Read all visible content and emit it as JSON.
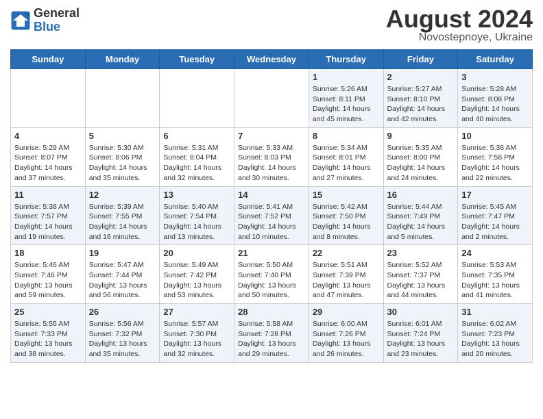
{
  "logo": {
    "general": "General",
    "blue": "Blue"
  },
  "title": "August 2024",
  "location": "Novostepnoye, Ukraine",
  "days_of_week": [
    "Sunday",
    "Monday",
    "Tuesday",
    "Wednesday",
    "Thursday",
    "Friday",
    "Saturday"
  ],
  "weeks": [
    [
      {
        "day": "",
        "info": ""
      },
      {
        "day": "",
        "info": ""
      },
      {
        "day": "",
        "info": ""
      },
      {
        "day": "",
        "info": ""
      },
      {
        "day": "1",
        "info": "Sunrise: 5:26 AM\nSunset: 8:11 PM\nDaylight: 14 hours\nand 45 minutes."
      },
      {
        "day": "2",
        "info": "Sunrise: 5:27 AM\nSunset: 8:10 PM\nDaylight: 14 hours\nand 42 minutes."
      },
      {
        "day": "3",
        "info": "Sunrise: 5:28 AM\nSunset: 8:08 PM\nDaylight: 14 hours\nand 40 minutes."
      }
    ],
    [
      {
        "day": "4",
        "info": "Sunrise: 5:29 AM\nSunset: 8:07 PM\nDaylight: 14 hours\nand 37 minutes."
      },
      {
        "day": "5",
        "info": "Sunrise: 5:30 AM\nSunset: 8:06 PM\nDaylight: 14 hours\nand 35 minutes."
      },
      {
        "day": "6",
        "info": "Sunrise: 5:31 AM\nSunset: 8:04 PM\nDaylight: 14 hours\nand 32 minutes."
      },
      {
        "day": "7",
        "info": "Sunrise: 5:33 AM\nSunset: 8:03 PM\nDaylight: 14 hours\nand 30 minutes."
      },
      {
        "day": "8",
        "info": "Sunrise: 5:34 AM\nSunset: 8:01 PM\nDaylight: 14 hours\nand 27 minutes."
      },
      {
        "day": "9",
        "info": "Sunrise: 5:35 AM\nSunset: 8:00 PM\nDaylight: 14 hours\nand 24 minutes."
      },
      {
        "day": "10",
        "info": "Sunrise: 5:36 AM\nSunset: 7:58 PM\nDaylight: 14 hours\nand 22 minutes."
      }
    ],
    [
      {
        "day": "11",
        "info": "Sunrise: 5:38 AM\nSunset: 7:57 PM\nDaylight: 14 hours\nand 19 minutes."
      },
      {
        "day": "12",
        "info": "Sunrise: 5:39 AM\nSunset: 7:55 PM\nDaylight: 14 hours\nand 16 minutes."
      },
      {
        "day": "13",
        "info": "Sunrise: 5:40 AM\nSunset: 7:54 PM\nDaylight: 14 hours\nand 13 minutes."
      },
      {
        "day": "14",
        "info": "Sunrise: 5:41 AM\nSunset: 7:52 PM\nDaylight: 14 hours\nand 10 minutes."
      },
      {
        "day": "15",
        "info": "Sunrise: 5:42 AM\nSunset: 7:50 PM\nDaylight: 14 hours\nand 8 minutes."
      },
      {
        "day": "16",
        "info": "Sunrise: 5:44 AM\nSunset: 7:49 PM\nDaylight: 14 hours\nand 5 minutes."
      },
      {
        "day": "17",
        "info": "Sunrise: 5:45 AM\nSunset: 7:47 PM\nDaylight: 14 hours\nand 2 minutes."
      }
    ],
    [
      {
        "day": "18",
        "info": "Sunrise: 5:46 AM\nSunset: 7:46 PM\nDaylight: 13 hours\nand 59 minutes."
      },
      {
        "day": "19",
        "info": "Sunrise: 5:47 AM\nSunset: 7:44 PM\nDaylight: 13 hours\nand 56 minutes."
      },
      {
        "day": "20",
        "info": "Sunrise: 5:49 AM\nSunset: 7:42 PM\nDaylight: 13 hours\nand 53 minutes."
      },
      {
        "day": "21",
        "info": "Sunrise: 5:50 AM\nSunset: 7:40 PM\nDaylight: 13 hours\nand 50 minutes."
      },
      {
        "day": "22",
        "info": "Sunrise: 5:51 AM\nSunset: 7:39 PM\nDaylight: 13 hours\nand 47 minutes."
      },
      {
        "day": "23",
        "info": "Sunrise: 5:52 AM\nSunset: 7:37 PM\nDaylight: 13 hours\nand 44 minutes."
      },
      {
        "day": "24",
        "info": "Sunrise: 5:53 AM\nSunset: 7:35 PM\nDaylight: 13 hours\nand 41 minutes."
      }
    ],
    [
      {
        "day": "25",
        "info": "Sunrise: 5:55 AM\nSunset: 7:33 PM\nDaylight: 13 hours\nand 38 minutes."
      },
      {
        "day": "26",
        "info": "Sunrise: 5:56 AM\nSunset: 7:32 PM\nDaylight: 13 hours\nand 35 minutes."
      },
      {
        "day": "27",
        "info": "Sunrise: 5:57 AM\nSunset: 7:30 PM\nDaylight: 13 hours\nand 32 minutes."
      },
      {
        "day": "28",
        "info": "Sunrise: 5:58 AM\nSunset: 7:28 PM\nDaylight: 13 hours\nand 29 minutes."
      },
      {
        "day": "29",
        "info": "Sunrise: 6:00 AM\nSunset: 7:26 PM\nDaylight: 13 hours\nand 26 minutes."
      },
      {
        "day": "30",
        "info": "Sunrise: 6:01 AM\nSunset: 7:24 PM\nDaylight: 13 hours\nand 23 minutes."
      },
      {
        "day": "31",
        "info": "Sunrise: 6:02 AM\nSunset: 7:23 PM\nDaylight: 13 hours\nand 20 minutes."
      }
    ]
  ]
}
